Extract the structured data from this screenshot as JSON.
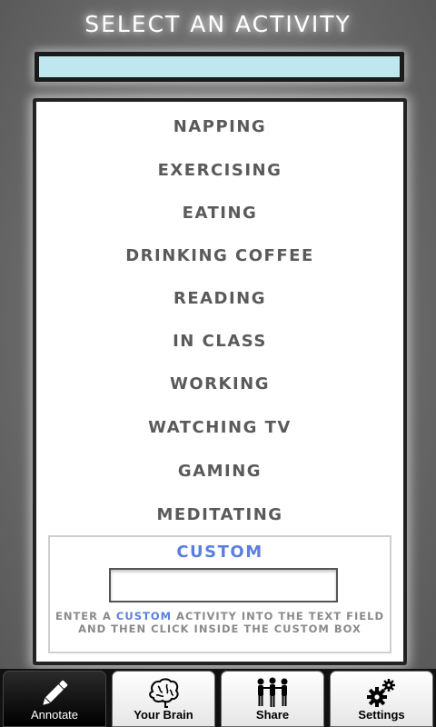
{
  "header": {
    "title": "SELECT AN ACTIVITY"
  },
  "activities": [
    {
      "label": "NAPPING",
      "name": "activity-napping"
    },
    {
      "label": "EXERCISING",
      "name": "activity-exercising"
    },
    {
      "label": "EATING",
      "name": "activity-eating"
    },
    {
      "label": "DRINKING COFFEE",
      "name": "activity-drinking-coffee"
    },
    {
      "label": "READING",
      "name": "activity-reading"
    },
    {
      "label": "IN CLASS",
      "name": "activity-in-class"
    },
    {
      "label": "WORKING",
      "name": "activity-working"
    },
    {
      "label": "WATCHING TV",
      "name": "activity-watching-tv"
    },
    {
      "label": "GAMING",
      "name": "activity-gaming"
    },
    {
      "label": "MEDITATING",
      "name": "activity-meditating"
    }
  ],
  "custom": {
    "title": "CUSTOM",
    "input_value": "",
    "help_part1": "ENTER A ",
    "help_highlight": "CUSTOM",
    "help_part2": " ACTIVITY INTO THE TEXT FIELD AND THEN CLICK INSIDE THE CUSTOM BOX"
  },
  "tabs": [
    {
      "label": "Annotate",
      "icon": "pencil-icon",
      "active": true
    },
    {
      "label": "Your Brain",
      "icon": "brain-icon",
      "active": false
    },
    {
      "label": "Share",
      "icon": "people-icon",
      "active": false
    },
    {
      "label": "Settings",
      "icon": "gears-icon",
      "active": false
    }
  ],
  "colors": {
    "accent": "#5b7fe0",
    "activity_text": "#5a5a5a",
    "progress_fill": "#bfe7ef"
  }
}
